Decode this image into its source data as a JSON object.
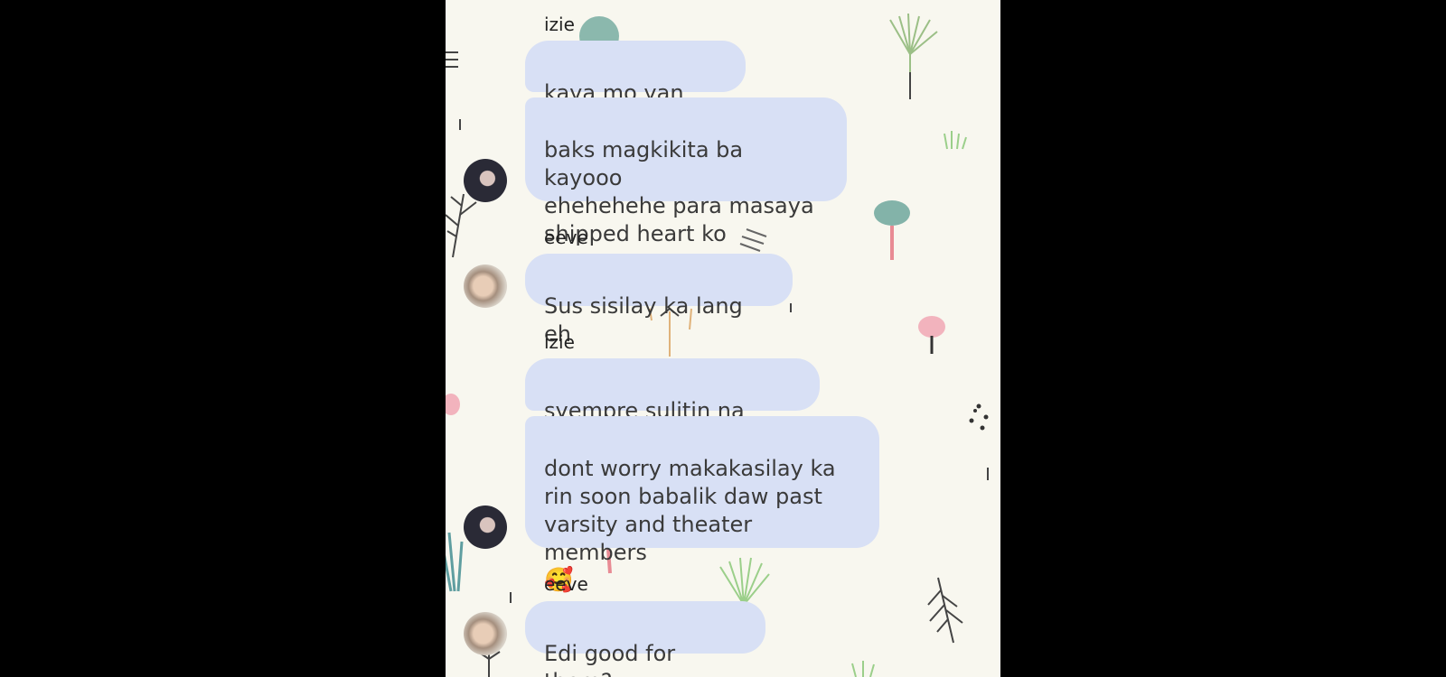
{
  "colors": {
    "outer_background": "#000000",
    "chat_background": "#f8f7ef",
    "bubble": "#d8e0f5",
    "bubble_text": "#3a3a3a",
    "sender_text": "#222222"
  },
  "messages": [
    {
      "sender": "izie",
      "text": "kaya mo yan inay"
    },
    {
      "text": "baks magkikita ba kayooo\nehehehehe para masaya\nshipped heart ko",
      "avatar": "dark-hair-avatar"
    },
    {
      "sender": "eeve",
      "text": "Sus sisilay ka lang eh",
      "avatar": "light-avatar"
    },
    {
      "sender": "izie",
      "text": "syempre sulitin na natin"
    },
    {
      "text": "dont worry makakasilay ka\nrin soon babalik daw past\nvarsity and theater members",
      "emoji": "🥰",
      "avatar": "dark-hair-avatar"
    },
    {
      "sender": "eeve",
      "text": "Edi good for them?",
      "avatar": "light-avatar"
    }
  ]
}
